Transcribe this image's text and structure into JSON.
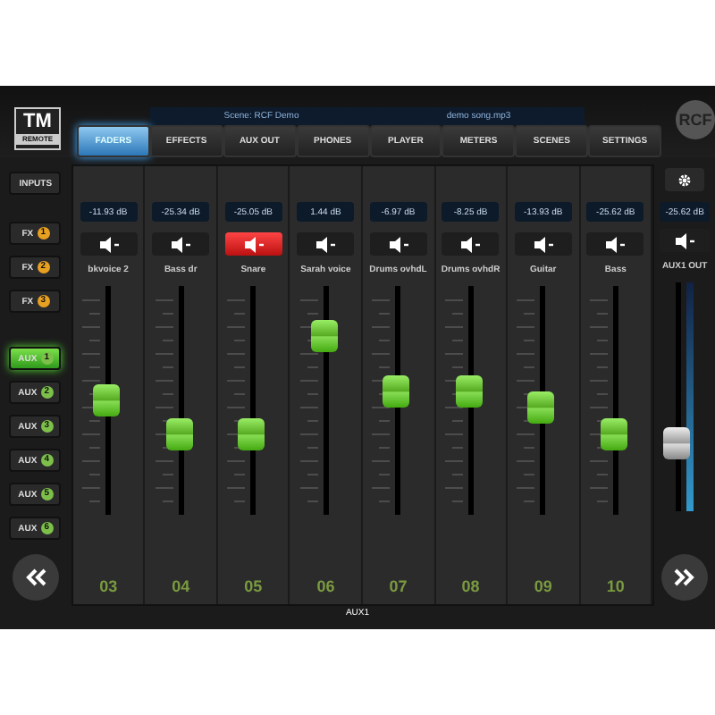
{
  "logo": {
    "title": "TM",
    "subtitle": "REMOTE"
  },
  "scene_bar": {
    "scene": "Scene: RCF Demo",
    "song": "demo song.mp3"
  },
  "tabs": [
    {
      "label": "FADERS",
      "selected": true
    },
    {
      "label": "EFFECTS",
      "selected": false
    },
    {
      "label": "AUX OUT",
      "selected": false
    },
    {
      "label": "PHONES",
      "selected": false
    },
    {
      "label": "PLAYER",
      "selected": false
    },
    {
      "label": "METERS",
      "selected": false
    },
    {
      "label": "SCENES",
      "selected": false
    },
    {
      "label": "SETTINGS",
      "selected": false
    }
  ],
  "brand": "RCF",
  "sidebar": {
    "inputs": "INPUTS",
    "buses": [
      {
        "kind": "fx",
        "label": "FX",
        "badge": "1",
        "selected": false
      },
      {
        "kind": "fx",
        "label": "FX",
        "badge": "2",
        "selected": false
      },
      {
        "kind": "fx",
        "label": "FX",
        "badge": "3",
        "selected": false
      },
      {
        "kind": "aux",
        "label": "AUX",
        "badge": "1",
        "selected": true
      },
      {
        "kind": "aux",
        "label": "AUX",
        "badge": "2",
        "selected": false
      },
      {
        "kind": "aux",
        "label": "AUX",
        "badge": "3",
        "selected": false
      },
      {
        "kind": "aux",
        "label": "AUX",
        "badge": "4",
        "selected": false
      },
      {
        "kind": "aux",
        "label": "AUX",
        "badge": "5",
        "selected": false
      },
      {
        "kind": "aux",
        "label": "AUX",
        "badge": "6",
        "selected": false
      }
    ]
  },
  "channels": [
    {
      "number": "03",
      "name": "bkvoice 2",
      "reading": "-11.93 dB",
      "muted": false,
      "level": 0.5
    },
    {
      "number": "04",
      "name": "Bass dr",
      "reading": "-25.34 dB",
      "muted": false,
      "level": 0.35
    },
    {
      "number": "05",
      "name": "Snare",
      "reading": "-25.05 dB",
      "muted": true,
      "level": 0.35
    },
    {
      "number": "06",
      "name": "Sarah voice",
      "reading": "1.44 dB",
      "muted": false,
      "level": 0.78
    },
    {
      "number": "07",
      "name": "Drums ovhdL",
      "reading": "-6.97 dB",
      "muted": false,
      "level": 0.54
    },
    {
      "number": "08",
      "name": "Drums ovhdR",
      "reading": "-8.25 dB",
      "muted": false,
      "level": 0.54
    },
    {
      "number": "09",
      "name": "Guitar",
      "reading": "-13.93 dB",
      "muted": false,
      "level": 0.47
    },
    {
      "number": "10",
      "name": "Bass",
      "reading": "-25.62 dB",
      "muted": false,
      "level": 0.35
    }
  ],
  "master": {
    "name": "AUX1 OUT",
    "reading": "-25.62 dB",
    "muted": false,
    "level": 0.3
  },
  "footer": {
    "label": "AUX1"
  }
}
